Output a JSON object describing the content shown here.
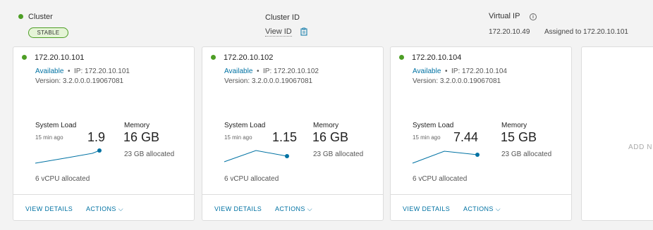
{
  "header": {
    "cluster_label": "Cluster",
    "cluster_status": "STABLE",
    "cluster_id_label": "Cluster ID",
    "view_id_link": "View ID",
    "virtual_ip_label": "Virtual IP",
    "virtual_ip_value": "172.20.10.49",
    "assigned_text": "Assigned to 172.20.10.101"
  },
  "colors": {
    "status_green": "#4d9e25",
    "link_blue": "#0072a3",
    "sparkline": "#0072a3"
  },
  "nodes": [
    {
      "ip": "172.20.10.101",
      "status": "Available",
      "ip_line": "IP: 172.20.10.101",
      "version": "Version: 3.2.0.0.0.19067081",
      "system_load_label": "System Load",
      "load_time": "15 min ago",
      "load_value": "1.9",
      "memory_label": "Memory",
      "memory_value": "16 GB",
      "memory_allocated": "23 GB allocated",
      "vcpu": "6 vCPU allocated",
      "view_details": "VIEW DETAILS",
      "actions": "ACTIONS"
    },
    {
      "ip": "172.20.10.102",
      "status": "Available",
      "ip_line": "IP: 172.20.10.102",
      "version": "Version: 3.2.0.0.0.19067081",
      "system_load_label": "System Load",
      "load_time": "15 min ago",
      "load_value": "1.15",
      "memory_label": "Memory",
      "memory_value": "16 GB",
      "memory_allocated": "23 GB allocated",
      "vcpu": "6 vCPU allocated",
      "view_details": "VIEW DETAILS",
      "actions": "ACTIONS"
    },
    {
      "ip": "172.20.10.104",
      "status": "Available",
      "ip_line": "IP: 172.20.10.104",
      "version": "Version: 3.2.0.0.0.19067081",
      "system_load_label": "System Load",
      "load_time": "15 min ago",
      "load_value": "7.44",
      "memory_label": "Memory",
      "memory_value": "15 GB",
      "memory_allocated": "23 GB allocated",
      "vcpu": "6 vCPU allocated",
      "view_details": "VIEW DETAILS",
      "actions": "ACTIONS"
    }
  ],
  "add_node": {
    "label": "ADD N"
  }
}
